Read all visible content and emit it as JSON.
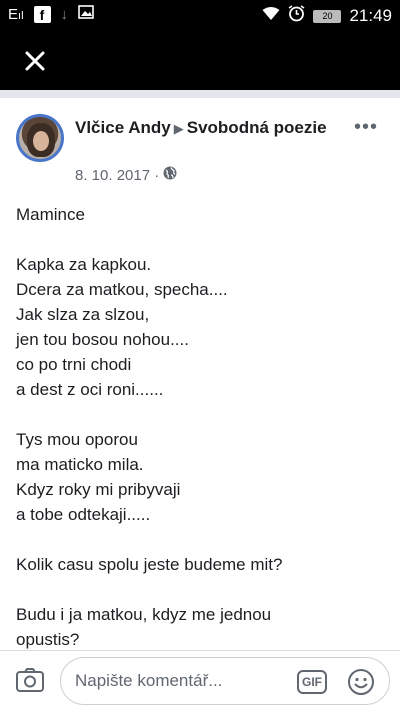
{
  "status_bar": {
    "carrier": "E",
    "signal": "ıl",
    "fb_notification": "f",
    "download_glyph": "↓",
    "battery": "20",
    "time": "21:49"
  },
  "post": {
    "author": "Vlčice Andy",
    "group": "Svobodná poezie",
    "date": "8. 10. 2017 ·",
    "stanzas": [
      [
        "Mamince"
      ],
      [
        "Kapka za kapkou.",
        "Dcera za matkou, specha....",
        "Jak slza za slzou,",
        "jen tou bosou nohou....",
        "co po trni chodi",
        "a dest z oci roni......"
      ],
      [
        "Tys mou oporou",
        "ma maticko mila.",
        "Kdyz roky mi pribyvaji",
        "a tobe odtekaji....."
      ],
      [
        "Kolik casu spolu jeste budeme mit?"
      ],
      [
        "Budu i ja matkou, kdyz me jednou",
        "opustis?"
      ]
    ]
  },
  "composer": {
    "placeholder": "Napište komentář...",
    "gif_label": "GIF"
  },
  "colors": {
    "header_bg": "#000000",
    "text": "#1c1e21",
    "secondary_text": "#606770",
    "avatar_ring": "#4a76c9"
  }
}
